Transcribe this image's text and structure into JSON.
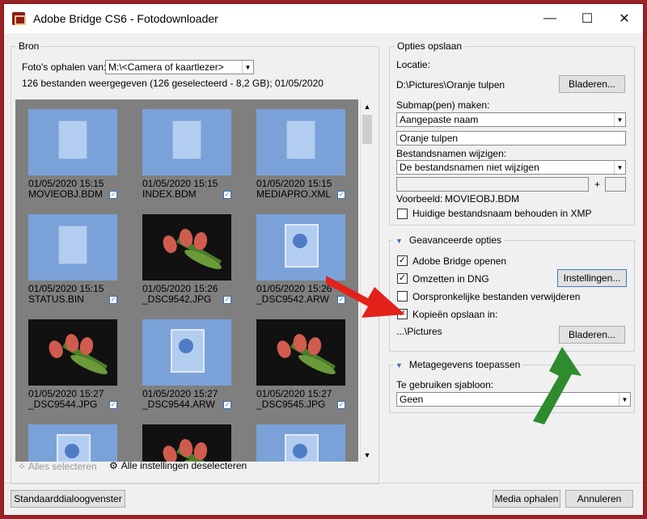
{
  "window": {
    "title": "Adobe Bridge CS6 - Fotodownloader",
    "min": "—",
    "max": "☐",
    "close": "✕"
  },
  "bron": {
    "legend": "Bron",
    "get_from_label": "Foto's ophalen van:",
    "get_from_value": "M:\\<Camera of kaartlezer>",
    "summary": "126 bestanden weergegeven (126 geselecteerd - 8,2 GB); 01/05/2020"
  },
  "thumbs": [
    {
      "date": "01/05/2020 15:15",
      "name": "MOVIEOBJ.BDM",
      "kind": "doc"
    },
    {
      "date": "01/05/2020 15:15",
      "name": "INDEX.BDM",
      "kind": "doc"
    },
    {
      "date": "01/05/2020 15:15",
      "name": "MEDIAPRO.XML",
      "kind": "doc"
    },
    {
      "date": "01/05/2020 15:15",
      "name": "STATUS.BIN",
      "kind": "doc"
    },
    {
      "date": "01/05/2020 15:26",
      "name": "_DSC9542.JPG",
      "kind": "photo"
    },
    {
      "date": "01/05/2020 15:26",
      "name": "_DSC9542.ARW",
      "kind": "pic"
    },
    {
      "date": "01/05/2020 15:27",
      "name": "_DSC9544.JPG",
      "kind": "photo"
    },
    {
      "date": "01/05/2020 15:27",
      "name": "_DSC9544.ARW",
      "kind": "pic"
    },
    {
      "date": "01/05/2020 15:27",
      "name": "_DSC9545.JPG",
      "kind": "photo"
    },
    {
      "date": "",
      "name": "",
      "kind": "pic"
    },
    {
      "date": "",
      "name": "",
      "kind": "photo"
    },
    {
      "date": "",
      "name": "",
      "kind": "pic"
    }
  ],
  "thumb_actions": {
    "select_all": "Alles selecteren",
    "deselect_all": "Alle instellingen deselecteren"
  },
  "opslaan": {
    "legend": "Opties opslaan",
    "location_label": "Locatie:",
    "location_value": "D:\\Pictures\\Oranje tulpen",
    "browse": "Bladeren...",
    "subfolder_label": "Submap(pen) maken:",
    "subfolder_value": "Aangepaste naam",
    "subfolder_name": "Oranje tulpen",
    "rename_label": "Bestandsnamen wijzigen:",
    "rename_value": "De bestandsnamen niet wijzigen",
    "plus": "+",
    "example_label": "Voorbeeld:",
    "example_value": "MOVIEOBJ.BDM",
    "keep_name": "Huidige bestandsnaam behouden in XMP"
  },
  "geavanceerd": {
    "legend": "Geavanceerde opties",
    "open_bridge": "Adobe Bridge openen",
    "convert_dng": "Omzetten in DNG",
    "settings": "Instellingen...",
    "delete_originals": "Oorspronkelijke bestanden verwijderen",
    "save_copies": "Kopieën opslaan in:",
    "copies_path": "...\\Pictures",
    "browse": "Bladeren..."
  },
  "metagegevens": {
    "legend": "Metagegevens toepassen",
    "template_label": "Te gebruiken sjabloon:",
    "template_value": "Geen"
  },
  "footer": {
    "standard": "Standaarddialoogvenster",
    "get_media": "Media ophalen",
    "cancel": "Annuleren"
  },
  "check_mark": "✓",
  "colors": {
    "frame": "#9b2226",
    "red_arrow": "#e32119",
    "green_arrow": "#2e8b2e"
  }
}
